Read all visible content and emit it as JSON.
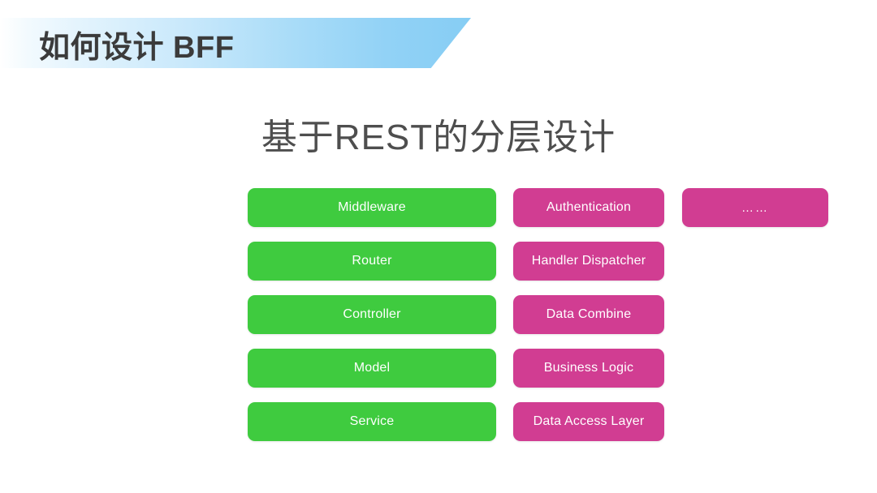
{
  "slide": {
    "title": "如何设计 BFF",
    "heading": "基于REST的分层设计"
  },
  "theme": {
    "banner_gradient_start": "#ffffff",
    "banner_gradient_end": "#86cdf4",
    "title_color": "#3b3b3b",
    "heading_color": "#4e4e4e",
    "green": "#3fcb3f",
    "pink": "#d13d92",
    "box_text_color": "#ffffff",
    "background": "#ffffff"
  },
  "diagram": {
    "columns": [
      {
        "id": "rest",
        "color": "green",
        "boxes": [
          {
            "label": "Middleware"
          },
          {
            "label": "Router"
          },
          {
            "label": "Controller"
          },
          {
            "label": "Model"
          },
          {
            "label": "Service"
          }
        ]
      },
      {
        "id": "bff",
        "color": "pink",
        "boxes": [
          {
            "label": "Authentication"
          },
          {
            "label": "Handler Dispatcher"
          },
          {
            "label": "Data Combine"
          },
          {
            "label": "Business Logic"
          },
          {
            "label": "Data Access Layer"
          }
        ]
      },
      {
        "id": "extra",
        "color": "pink",
        "boxes": [
          {
            "label": "……"
          }
        ]
      }
    ]
  }
}
